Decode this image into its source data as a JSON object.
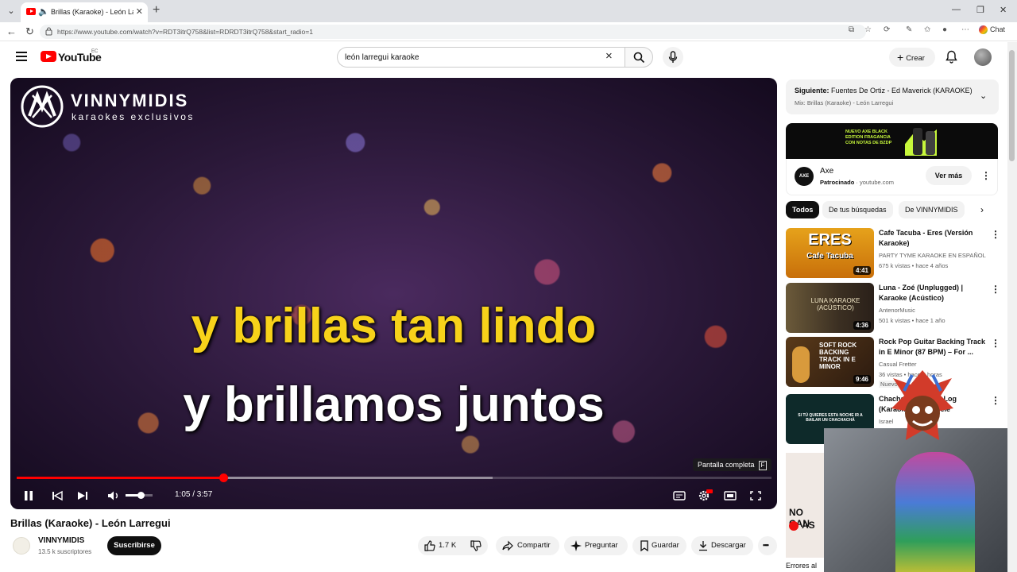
{
  "browser": {
    "tab_title": "Brillas (Karaoke) - León Larregui",
    "url": "https://www.youtube.com/watch?v=RDT3itrQ758&list=RDRDT3itrQ758&start_radio=1",
    "chat_label": "Chat"
  },
  "header": {
    "logo_text": "YouTube",
    "country_code": "EC",
    "search_query": "león larregui karaoke",
    "create_label": "Crear"
  },
  "player": {
    "brand": "VINNYMIDIS",
    "brand_sub": "karaokes exclusivos",
    "lyric_line1": "y brillas tan lindo",
    "lyric_line2": "y brillamos juntos",
    "tooltip": "Pantalla completa",
    "tooltip_key": "F",
    "time_display": "1:05 / 3:57",
    "progress_fraction": 0.274,
    "buffer_fraction": 0.63,
    "volume_fraction": 0.55
  },
  "video": {
    "title": "Brillas (Karaoke) - León Larregui",
    "channel": "VINNYMIDIS",
    "subscribers": "13.5 k suscriptores",
    "subscribe_label": "Suscribirse",
    "likes": "1.7 K",
    "share_label": "Compartir",
    "ask_label": "Preguntar",
    "save_label": "Guardar",
    "download_label": "Descargar"
  },
  "up_next": {
    "prefix": "Siguiente:",
    "title": "Fuentes De Ortiz - Ed Maverick (KARAOKE)",
    "mix": "Mix: Brillas (Karaoke) - León Larregui"
  },
  "ad": {
    "banner_text": "NUEVO AXE BLACK EDITION FRAGANCIA CON NOTAS DE BZDP",
    "logo_text": "AXE",
    "name": "Axe",
    "sponsored": "Patrocinado",
    "domain": "youtube.com",
    "cta": "Ver más"
  },
  "chips": [
    "Todos",
    "De tus búsquedas",
    "De VINNYMIDIS"
  ],
  "recommendations": [
    {
      "title": "Cafe Tacuba - Eres (Versión Karaoke)",
      "channel": "PARTY TYME KARAOKE EN ESPAÑOL",
      "stats": "675 k vistas • hace 4 años",
      "duration": "4:41",
      "thumb_big": "ERES",
      "thumb_small": "Cafe Tacuba"
    },
    {
      "title": "Luna - Zoé (Unplugged) | Karaoke (Acústico)",
      "channel": "AntenorMusic",
      "stats": "501 k vistas • hace 1 año",
      "duration": "4:36",
      "thumb_text": "LUNA KARAOKE (ACÚSTICO)"
    },
    {
      "title": "Rock Pop Guitar Backing Track in E Minor (87 BPM) – For ...",
      "channel": "Casual Fretter",
      "stats": "36 vistas • hace 8 horas",
      "badge": "Nuevo",
      "duration": "9:46",
      "thumb_text": "SOFT ROCK BACKING TRACK IN E MINOR"
    },
    {
      "title": "Chachachá – Juan Log (Karaoke) SinUkulele",
      "channel": "Israel",
      "thumb_text": "SI TÚ QUIERES ESTA NOCHE IR A BAILAR UN CHACHACHÁ"
    }
  ],
  "side_thumb": {
    "line1": "NO CAN",
    "line2": "AS"
  },
  "errors_label": "Errores al"
}
